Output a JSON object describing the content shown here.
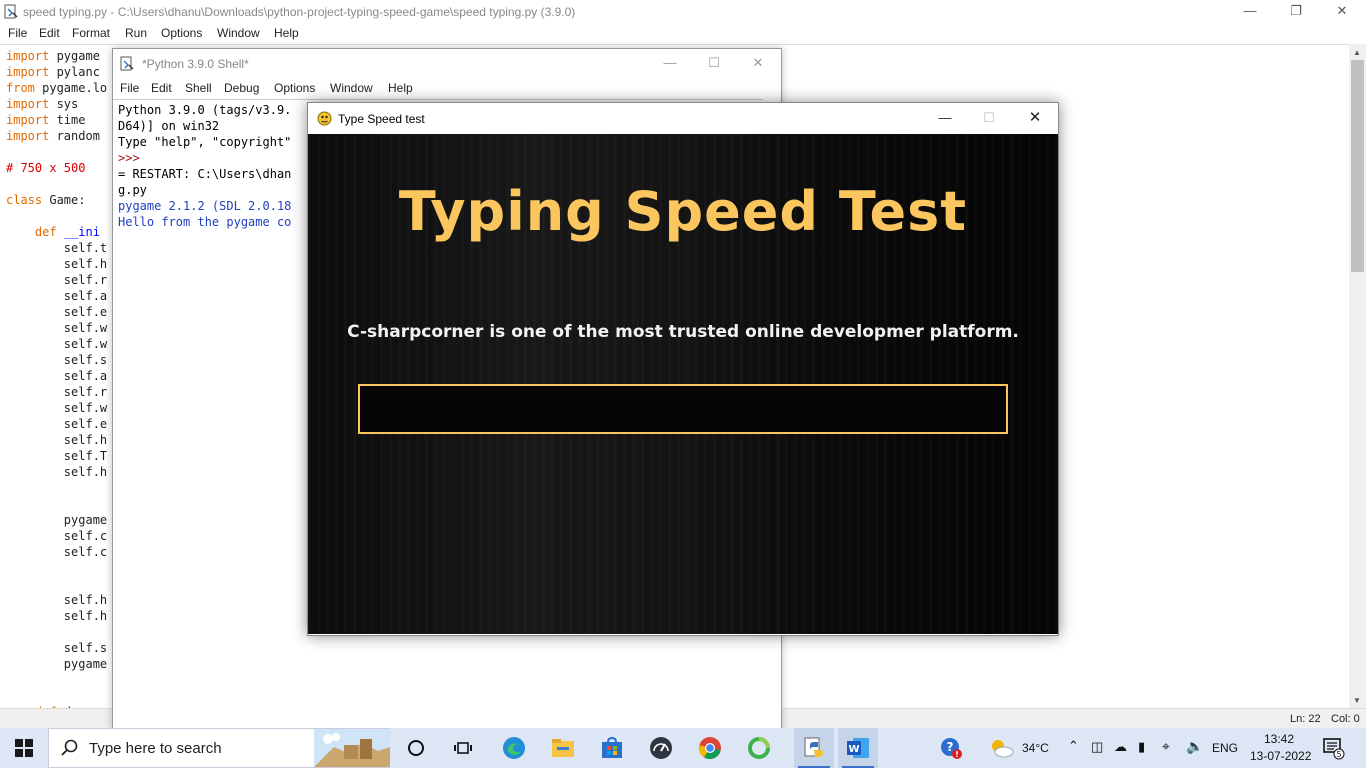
{
  "editor": {
    "title": "speed typing.py - C:\\Users\\dhanu\\Downloads\\python-project-typing-speed-game\\speed typing.py (3.9.0)",
    "menu": [
      "File",
      "Edit",
      "Format",
      "Run",
      "Options",
      "Window",
      "Help"
    ],
    "code_lines": [
      {
        "kw": "import",
        "rest": " pygame"
      },
      {
        "kw": "import",
        "rest": " pylanc"
      },
      {
        "kw": "from",
        "rest": " pygame.lo"
      },
      {
        "kw": "import",
        "rest": " sys"
      },
      {
        "kw": "import",
        "rest": " time"
      },
      {
        "kw": "import",
        "rest": " random"
      },
      {
        "kw": "",
        "rest": ""
      },
      {
        "comment": "# 750 x 500"
      },
      {
        "kw": "",
        "rest": ""
      },
      {
        "kw": "class",
        "rest": " Game:"
      },
      {
        "kw": "",
        "rest": ""
      },
      {
        "kw": "    def",
        "rest": " __ini",
        "blue": true
      },
      {
        "rest": "        self.t"
      },
      {
        "rest": "        self.h"
      },
      {
        "rest": "        self.r"
      },
      {
        "rest": "        self.a"
      },
      {
        "rest": "        self.e"
      },
      {
        "rest": "        self.w"
      },
      {
        "rest": "        self.w"
      },
      {
        "rest": "        self.s"
      },
      {
        "rest": "        self.a"
      },
      {
        "rest": "        self.r"
      },
      {
        "rest": "        self.w"
      },
      {
        "rest": "        self.e"
      },
      {
        "rest": "        self.h"
      },
      {
        "rest": "        self.T"
      },
      {
        "rest": "        self.h"
      },
      {
        "rest": ""
      },
      {
        "rest": ""
      },
      {
        "rest": "        pygame"
      },
      {
        "rest": "        self.c"
      },
      {
        "rest": "        self.c"
      },
      {
        "rest": ""
      },
      {
        "rest": ""
      },
      {
        "rest": "        self.h"
      },
      {
        "rest": "        self.h"
      },
      {
        "rest": ""
      },
      {
        "rest": "        self.s"
      },
      {
        "rest": "        pygame"
      },
      {
        "rest": ""
      },
      {
        "rest": ""
      },
      {
        "kw": "    def",
        "rest": " draw_"
      }
    ],
    "status_line": "Ln: 22",
    "status_col": "Col: 0"
  },
  "shell": {
    "title": "*Python 3.9.0 Shell*",
    "menu": [
      "File",
      "Edit",
      "Shell",
      "Debug",
      "Options",
      "Window",
      "Help"
    ],
    "lines": [
      {
        "text": "Python 3.9.0 (tags/v3.9.",
        "color": "#000000"
      },
      {
        "text": "D64)] on win32",
        "color": "#000000"
      },
      {
        "text": "Type \"help\", \"copyright\"",
        "color": "#000000"
      },
      {
        "text": ">>>",
        "color": "#a31515"
      },
      {
        "text": "= RESTART: C:\\Users\\dhan",
        "color": "#000000"
      },
      {
        "text": "g.py",
        "color": "#000000"
      },
      {
        "text": "pygame 2.1.2 (SDL 2.0.18",
        "color": "#1f3fbf"
      },
      {
        "text": "Hello from the pygame co",
        "color": "#1f3fbf"
      }
    ]
  },
  "pygame_window": {
    "title": "Type Speed test",
    "heading": "Typing Speed Test",
    "sentence": "C-sharpcorner is one of the most trusted online developmer platform.",
    "input_value": "",
    "colors": {
      "heading": "#fbc65e",
      "sentence": "#f2f2f2",
      "input_border": "#fbc65e"
    }
  },
  "taskbar": {
    "search_placeholder": "Type here to search",
    "apps": [
      "cortana-icon",
      "task-view-icon",
      "edge-icon",
      "file-explorer-icon",
      "store-icon",
      "speedometer-icon",
      "chrome-icon",
      "green-circle-app-icon",
      "python-idle-icon",
      "word-icon"
    ],
    "help_badge": "!",
    "temperature": "34°C",
    "language": "ENG",
    "time": "13:42",
    "date": "13-07-2022",
    "notification_count": "5"
  }
}
